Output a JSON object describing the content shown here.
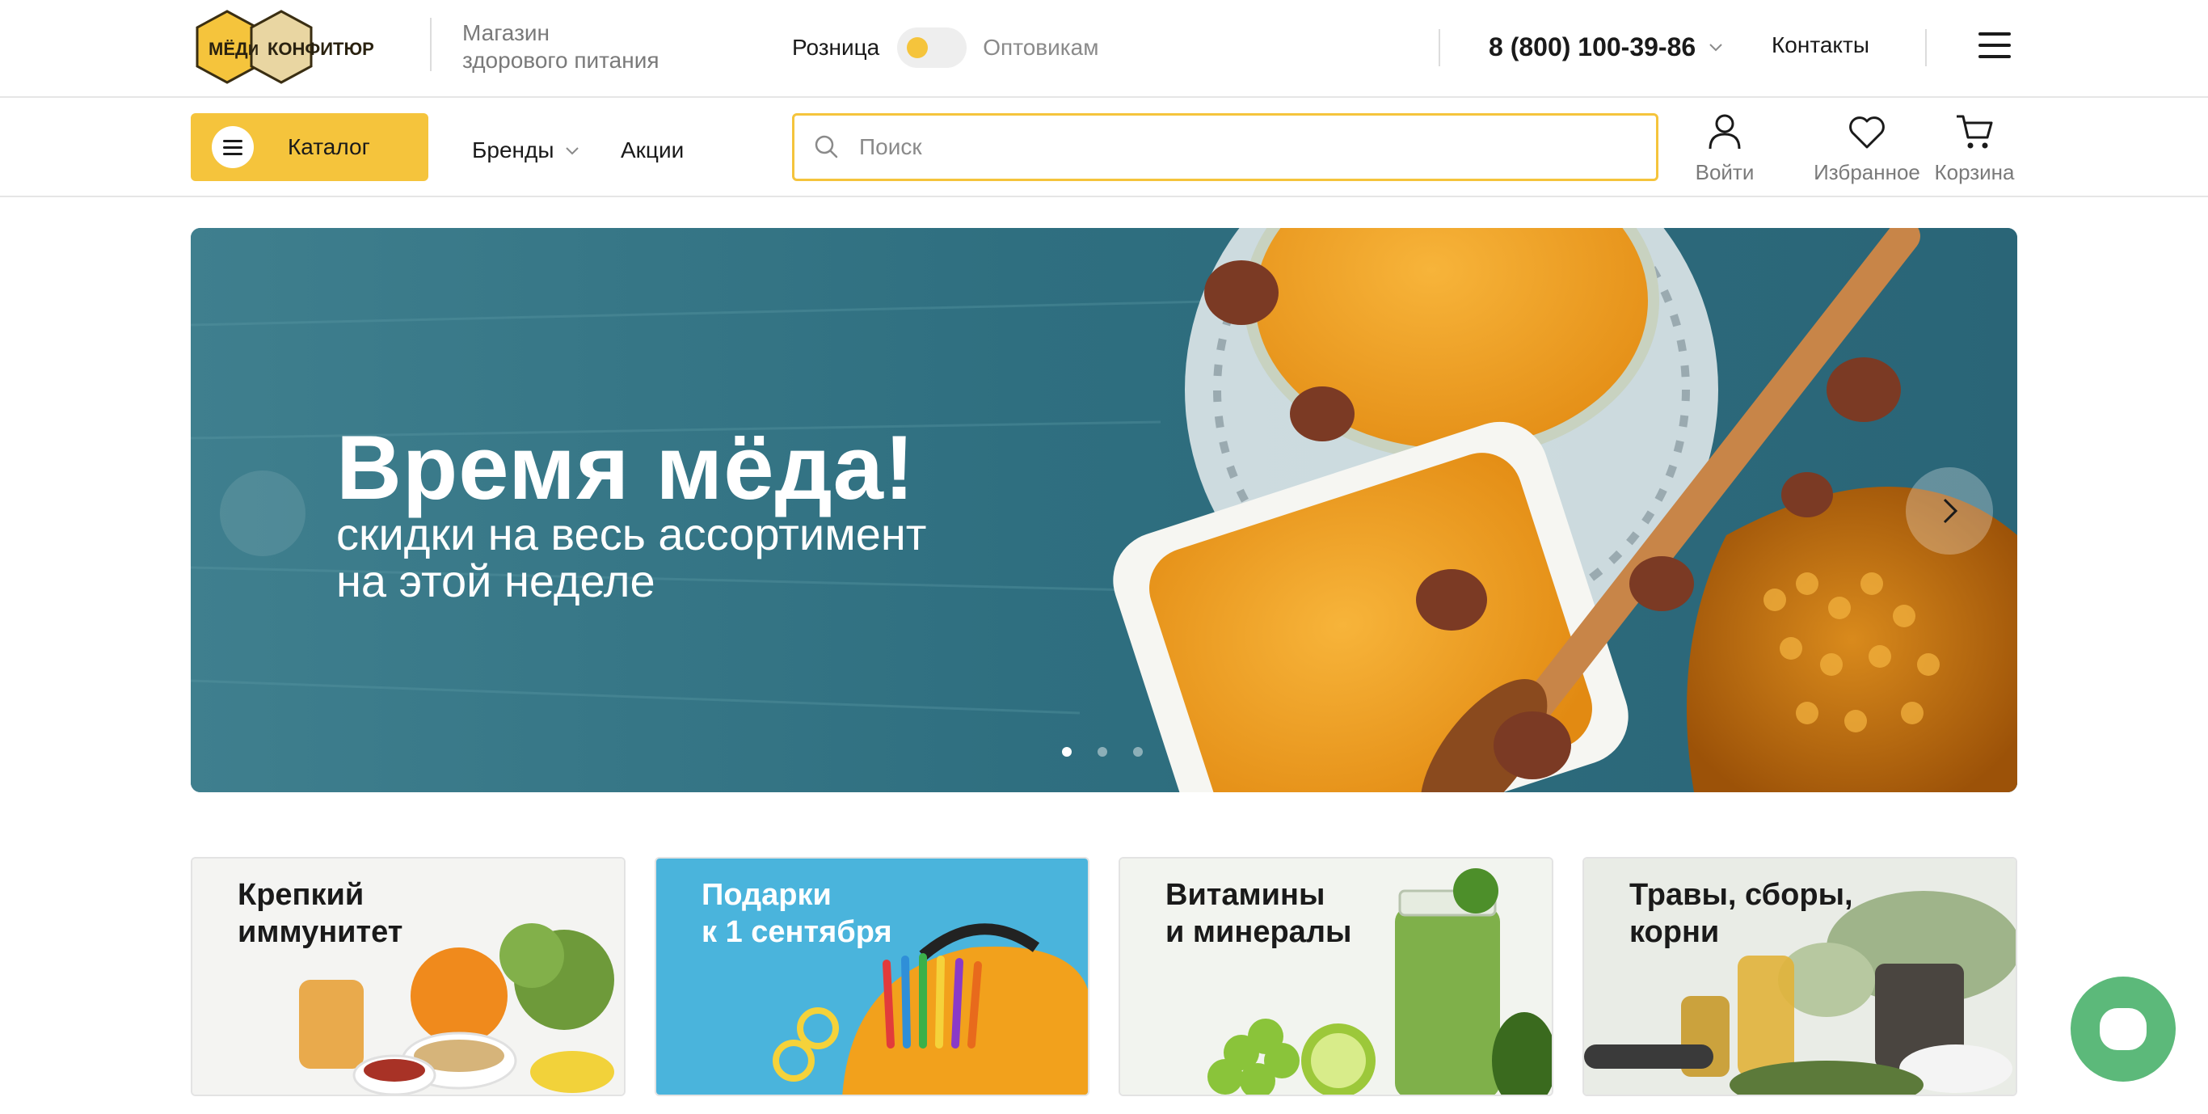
{
  "brand": {
    "logo_text": "МЁД И КОНФИТЮР",
    "tagline_line1": "Магазин",
    "tagline_line2": "здорового питания"
  },
  "header": {
    "mode_retail": "Розница",
    "mode_wholesale": "Оптовикам",
    "phone": "8 (800) 100-39-86",
    "contacts": "Контакты"
  },
  "nav": {
    "catalog": "Каталог",
    "brands": "Бренды",
    "sales": "Акции",
    "search_placeholder": "Поиск",
    "login": "Войти",
    "favorites": "Избранное",
    "cart": "Корзина"
  },
  "hero": {
    "title": "Время мёда!",
    "subtitle_line1": "скидки на весь ассортимент",
    "subtitle_line2": "на этой неделе",
    "active_slide": 1,
    "slide_count": 3
  },
  "categories": [
    {
      "line1": "Крепкий",
      "line2": "иммунитет"
    },
    {
      "line1": "Подарки",
      "line2": "к 1 сентября"
    },
    {
      "line1": "Витамины",
      "line2": "и минералы"
    },
    {
      "line1": "Травы, сборы,",
      "line2": "корни"
    }
  ],
  "colors": {
    "accent": "#f5c43c",
    "chat": "#5cb97a",
    "hero_bg": "#2a6a7d",
    "gift_card_bg": "#4ab4dc"
  }
}
